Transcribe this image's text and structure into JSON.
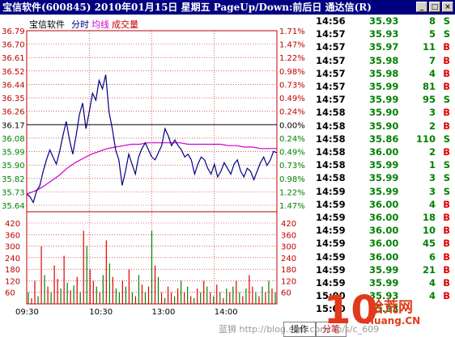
{
  "title": "宝信软件(600845)  2010年01月15日  星期五  PageUp/Down:前后日  通达信(R)",
  "window_buttons": [
    "_",
    "□",
    "×"
  ],
  "legend": {
    "name": "宝信软件",
    "fenshi": "分时",
    "junxian": "均线",
    "chengjiao": "成交量"
  },
  "colors": {
    "price": "#000080",
    "avg": "#cc00cc",
    "up": "#e00000",
    "down": "#008000",
    "grid_red": "#c00000"
  },
  "chart_data": {
    "type": "line",
    "price_ticks": [
      "36.79",
      "36.70",
      "36.61",
      "36.52",
      "36.44",
      "36.35",
      "36.26",
      "36.17",
      "36.08",
      "35.99",
      "35.90",
      "35.82",
      "35.73",
      "35.64"
    ],
    "pct_ticks": [
      "1.71%",
      "1.47%",
      "1.22%",
      "0.98%",
      "0.73%",
      "0.49%",
      "0.24%",
      "0.00%",
      "0.24%",
      "0.49%",
      "0.73%",
      "0.98%",
      "1.22%",
      "1.47%"
    ],
    "ylim": [
      35.56,
      36.79
    ],
    "prev_close": 36.17,
    "x_ticks": [
      "09:30",
      "10:30",
      "13:00",
      "14:00"
    ],
    "price_series": [
      35.64,
      35.62,
      35.58,
      35.66,
      35.7,
      35.8,
      35.88,
      35.95,
      35.9,
      35.85,
      35.94,
      36.05,
      36.15,
      36.02,
      35.92,
      36.05,
      36.2,
      36.28,
      36.1,
      36.22,
      36.35,
      36.3,
      36.44,
      36.38,
      36.48,
      36.22,
      36.1,
      35.95,
      35.88,
      35.7,
      35.8,
      35.92,
      35.85,
      35.78,
      35.9,
      35.96,
      36.0,
      35.95,
      35.9,
      35.88,
      35.93,
      35.98,
      36.1,
      36.05,
      35.98,
      36.02,
      35.98,
      35.95,
      35.9,
      35.92,
      35.88,
      35.78,
      35.85,
      35.9,
      35.88,
      35.82,
      35.78,
      35.85,
      35.76,
      35.8,
      35.86,
      35.82,
      35.78,
      35.85,
      35.88,
      35.8,
      35.76,
      35.82,
      35.8,
      35.74,
      35.8,
      35.86,
      35.9,
      35.84,
      35.88,
      35.94,
      35.93
    ],
    "avg_series": [
      35.64,
      35.66,
      35.69,
      35.73,
      35.77,
      35.82,
      35.86,
      35.89,
      35.92,
      35.94,
      35.96,
      35.97,
      35.98,
      35.99,
      35.99,
      36.0,
      36.0,
      36.0,
      36.0,
      36.0,
      35.99,
      35.99,
      35.99,
      35.99,
      35.99,
      35.98,
      35.98,
      35.97,
      35.97,
      35.96,
      35.96,
      35.96
    ],
    "volume_ticks": [
      "420",
      "360",
      "300",
      "240",
      "180",
      "120",
      "60"
    ],
    "volume_max": 420,
    "volume": [
      60,
      30,
      120,
      40,
      300,
      150,
      90,
      60,
      200,
      130,
      80,
      250,
      110,
      70,
      95,
      140,
      60,
      380,
      300,
      180,
      120,
      90,
      60,
      150,
      330,
      210,
      140,
      80,
      60,
      120,
      90,
      180,
      60,
      40,
      150,
      100,
      60,
      90,
      380,
      200,
      140,
      60,
      30,
      90,
      60,
      40,
      80,
      120,
      60,
      90,
      40,
      30,
      80,
      60,
      120,
      90,
      60,
      40,
      100,
      60,
      30,
      80,
      60,
      90,
      120,
      60,
      40,
      80,
      150,
      90,
      60,
      40,
      90,
      60,
      120,
      80,
      60
    ],
    "volume_dir": [
      "d",
      "u",
      "u",
      "d",
      "u",
      "d",
      "u",
      "d",
      "u",
      "u",
      "d",
      "u",
      "d",
      "u",
      "d",
      "u",
      "d",
      "u",
      "d",
      "u",
      "u",
      "d",
      "u",
      "d",
      "u",
      "d",
      "u",
      "d",
      "d",
      "u",
      "d",
      "u",
      "d",
      "u",
      "d",
      "u",
      "d",
      "u",
      "d",
      "u",
      "d",
      "u",
      "d",
      "u",
      "u",
      "d",
      "u",
      "d",
      "u",
      "d",
      "u",
      "d",
      "u",
      "d",
      "u",
      "d",
      "u",
      "d",
      "u",
      "d",
      "u",
      "d",
      "u",
      "d",
      "u",
      "d",
      "u",
      "d",
      "u",
      "u",
      "d",
      "u",
      "d",
      "u",
      "d",
      "u",
      "d"
    ]
  },
  "ticks_list": [
    {
      "time": "14:56",
      "price": "35.93",
      "vol": "8",
      "dir": "S"
    },
    {
      "time": "14:57",
      "price": "35.93",
      "vol": "5",
      "dir": "S"
    },
    {
      "time": "14:57",
      "price": "35.97",
      "vol": "11",
      "dir": "B"
    },
    {
      "time": "14:57",
      "price": "35.98",
      "vol": "7",
      "dir": "B"
    },
    {
      "time": "14:57",
      "price": "35.98",
      "vol": "4",
      "dir": "B"
    },
    {
      "time": "14:57",
      "price": "35.99",
      "vol": "81",
      "dir": "B"
    },
    {
      "time": "14:57",
      "price": "35.99",
      "vol": "95",
      "dir": "S"
    },
    {
      "time": "14:58",
      "price": "35.90",
      "vol": "3",
      "dir": "B"
    },
    {
      "time": "14:58",
      "price": "35.90",
      "vol": "2",
      "dir": "B"
    },
    {
      "time": "14:58",
      "price": "35.86",
      "vol": "110",
      "dir": "S"
    },
    {
      "time": "14:58",
      "price": "36.00",
      "vol": "2",
      "dir": "B"
    },
    {
      "time": "14:58",
      "price": "35.99",
      "vol": "1",
      "dir": "S"
    },
    {
      "time": "14:58",
      "price": "35.99",
      "vol": "3",
      "dir": "S"
    },
    {
      "time": "14:59",
      "price": "35.99",
      "vol": "3",
      "dir": "S"
    },
    {
      "time": "14:59",
      "price": "36.00",
      "vol": "4",
      "dir": "B"
    },
    {
      "time": "14:59",
      "price": "36.00",
      "vol": "18",
      "dir": "B"
    },
    {
      "time": "14:59",
      "price": "36.00",
      "vol": "10",
      "dir": "B"
    },
    {
      "time": "14:59",
      "price": "36.00",
      "vol": "45",
      "dir": "B"
    },
    {
      "time": "14:59",
      "price": "36.00",
      "vol": "6",
      "dir": "B"
    },
    {
      "time": "14:59",
      "price": "35.99",
      "vol": "21",
      "dir": "B"
    },
    {
      "time": "14:59",
      "price": "35.99",
      "vol": "4",
      "dir": "B"
    },
    {
      "time": "15:00",
      "price": "35.93",
      "vol": "4",
      "dir": "B"
    },
    {
      "time": "15:00",
      "price": "35.93",
      "vol": "",
      "dir": ""
    }
  ],
  "bottom": {
    "tab_action": "操作",
    "tab_fenbi": "分笔",
    "watermark": "蓝狮 http://blog.sina.com.cn/s/c_609"
  },
  "logo": {
    "ten": "10",
    "site": "拾荒网",
    "url": "Huang.CN"
  }
}
